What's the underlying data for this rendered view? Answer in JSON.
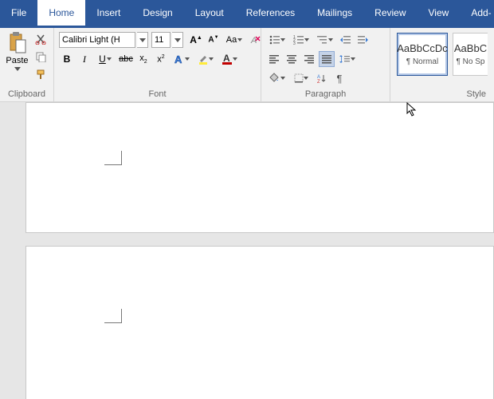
{
  "tabs": [
    "File",
    "Home",
    "Insert",
    "Design",
    "Layout",
    "References",
    "Mailings",
    "Review",
    "View",
    "Add-in"
  ],
  "active_tab": 1,
  "clipboard": {
    "label": "Clipboard",
    "paste": "Paste"
  },
  "font": {
    "label": "Font",
    "name": "Calibri Light (H",
    "size": "11",
    "buttons": {
      "bold": "B",
      "italic": "I",
      "underline": "U"
    }
  },
  "paragraph": {
    "label": "Paragraph"
  },
  "styles": {
    "label": "Style",
    "items": [
      {
        "preview": "AaBbCcDc",
        "name": "¶ Normal",
        "selected": true
      },
      {
        "preview": "AaBbC",
        "name": "¶ No Sp",
        "selected": false
      }
    ]
  },
  "colors": {
    "accent": "#2b579a",
    "highlight": "#ffeb3b",
    "fontcolor": "#c00000"
  }
}
